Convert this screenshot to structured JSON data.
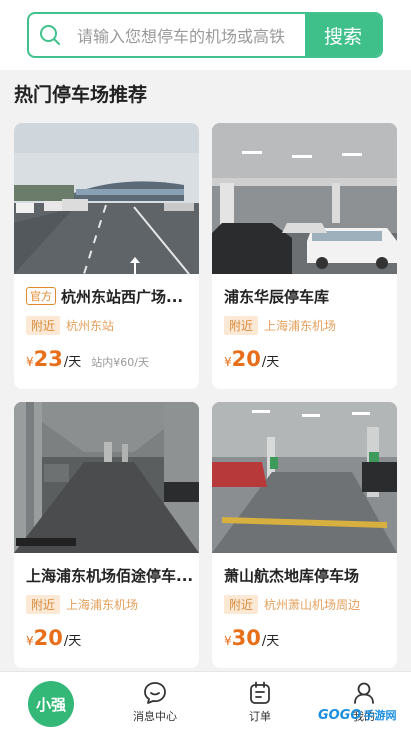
{
  "search": {
    "placeholder": "请输入您想停车的机场或高铁",
    "button": "搜索"
  },
  "section_title": "热门停车场推荐",
  "cards": [
    {
      "official": "官方",
      "name": "杭州东站西广场...",
      "near": "附近",
      "place": "杭州东站",
      "yen": "¥",
      "price": "23",
      "unit": "/天",
      "station_price": "站内¥60/天"
    },
    {
      "name": "浦东华辰停车库",
      "near": "附近",
      "place": "上海浦东机场",
      "yen": "¥",
      "price": "20",
      "unit": "/天"
    },
    {
      "name": "上海浦东机场佰途停车...",
      "near": "附近",
      "place": "上海浦东机场",
      "yen": "¥",
      "price": "20",
      "unit": "/天"
    },
    {
      "name": "萧山航杰地库停车场",
      "near": "附近",
      "place": "杭州萧山机场周边",
      "yen": "¥",
      "price": "30",
      "unit": "/天"
    }
  ],
  "tabbar": {
    "home": "小强",
    "messages": "消息中心",
    "orders": "订单",
    "mine": "我的"
  },
  "watermark": {
    "logo": "GOGO",
    "text": "手游网"
  },
  "colors": {
    "accent": "#3fc08a",
    "price": "#e86f1a",
    "tag_bg": "#fbe9d6"
  }
}
